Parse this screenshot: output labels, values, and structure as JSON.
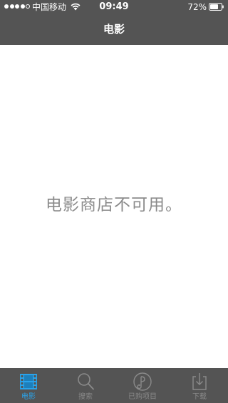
{
  "status_bar": {
    "carrier": "中国移动",
    "time": "09:49",
    "battery": "72%",
    "signal_bars_filled": 4,
    "signal_bars_total": 5
  },
  "nav": {
    "title": "电影"
  },
  "main": {
    "message": "电影商店不可用。"
  },
  "tabs": [
    {
      "label": "电影",
      "icon": "film-icon",
      "active": true
    },
    {
      "label": "搜索",
      "icon": "search-icon",
      "active": false
    },
    {
      "label": "已购项目",
      "icon": "purchased-icon",
      "active": false
    },
    {
      "label": "下载",
      "icon": "download-icon",
      "active": false
    }
  ],
  "colors": {
    "bar_background": "#545454",
    "active_tint": "#2aa3ea",
    "inactive_tint": "#8a8a8a",
    "message_text": "#8b8b8b"
  }
}
